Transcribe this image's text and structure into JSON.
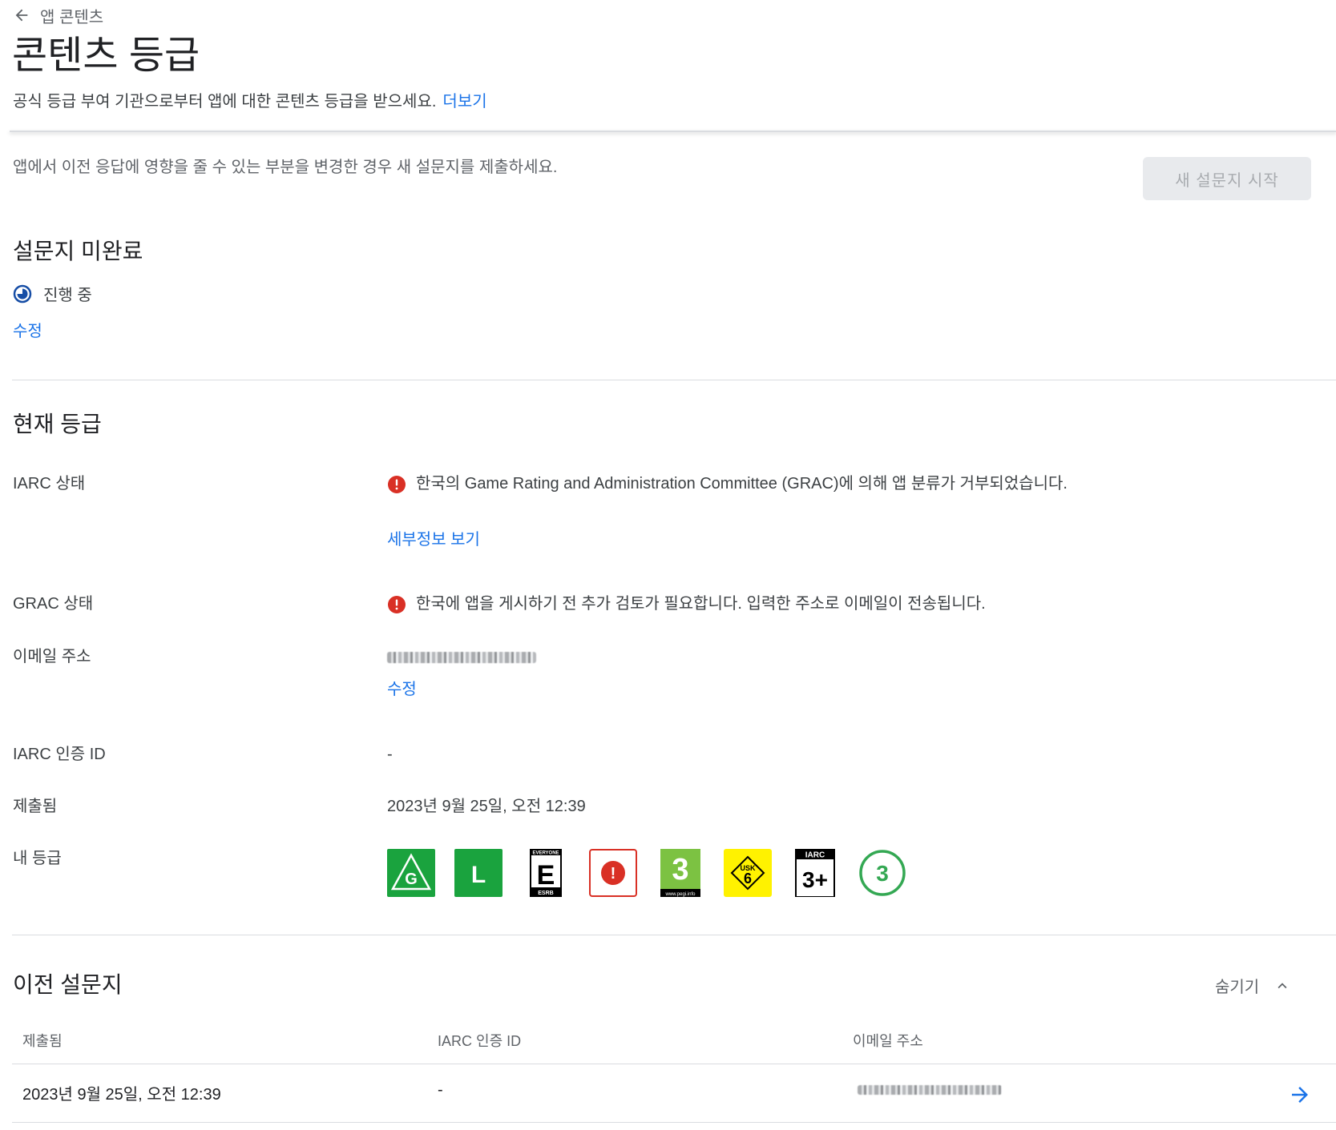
{
  "back": {
    "label": "앱 콘텐츠"
  },
  "page": {
    "title": "콘텐츠 등급",
    "subtitle": "공식 등급 부여 기관으로부터 앱에 대한 콘텐츠 등급을 받으세요.",
    "learn_more": "더보기"
  },
  "intro": {
    "text": "앱에서 이전 응답에 영향을 줄 수 있는 부분을 변경한 경우 새 설문지를 제출하세요.",
    "start_button": "새 설문지 시작"
  },
  "incomplete": {
    "title": "설문지 미완료",
    "status": "진행 중",
    "edit": "수정"
  },
  "current": {
    "title": "현재 등급",
    "iarc_status_label": "IARC 상태",
    "iarc_status_text": "한국의 Game Rating and Administration Committee (GRAC)에 의해 앱 분류가 거부되었습니다.",
    "details_link": "세부정보 보기",
    "grac_status_label": "GRAC 상태",
    "grac_status_text": "한국에 앱을 게시하기 전 추가 검토가 필요합니다. 입력한 주소로 이메일이 전송됩니다.",
    "email_label": "이메일 주소",
    "email_edit": "수정",
    "cert_label": "IARC 인증 ID",
    "cert_value": "-",
    "submitted_label": "제출됨",
    "submitted_value": "2023년 9월 25일, 오전 12:39",
    "my_rating_label": "내 등급"
  },
  "badges": [
    {
      "name": "australia-g-badge",
      "text": "G"
    },
    {
      "name": "brazil-l-badge",
      "text": "L"
    },
    {
      "name": "esrb-everyone-badge",
      "text": "E",
      "top": "EVERYONE",
      "bottom": "ESRB"
    },
    {
      "name": "refused-classification-badge",
      "text": "!"
    },
    {
      "name": "pegi-3-badge",
      "text": "3",
      "bottom": "www.pegi.info"
    },
    {
      "name": "usk-6-badge",
      "text": "6",
      "top": "USK"
    },
    {
      "name": "iarc-3-plus-badge",
      "text": "3+",
      "top": "IARC"
    },
    {
      "name": "generic-3-badge",
      "text": "3"
    }
  ],
  "previous": {
    "title": "이전 설문지",
    "hide": "숨기기",
    "columns": [
      "제출됨",
      "IARC 인증 ID",
      "이메일 주소"
    ],
    "rows": [
      {
        "submitted": "2023년 9월 25일, 오전 12:39",
        "cert_id": "-"
      }
    ]
  },
  "colors": {
    "link": "#1a73e8",
    "error": "#d93025",
    "in_progress": "#174ea6",
    "badge_green": "#1aa33e",
    "pegi_green": "#7cc242",
    "usk_yellow": "#fff200"
  }
}
